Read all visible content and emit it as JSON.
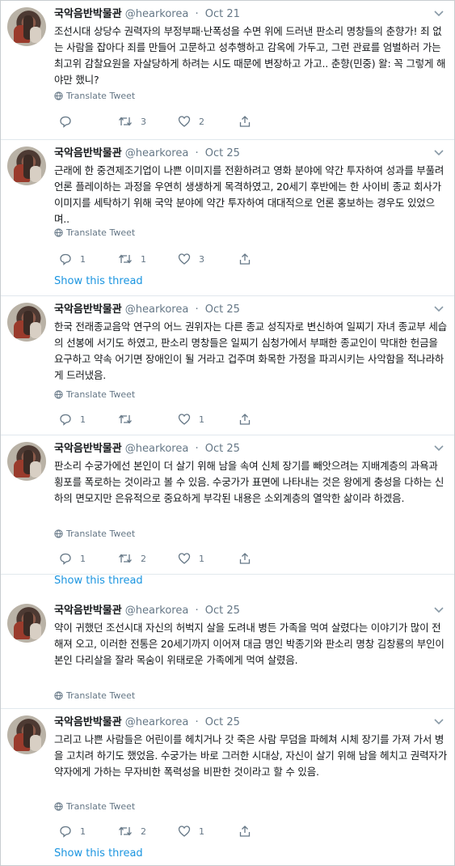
{
  "labels": {
    "translate": "Translate Tweet",
    "show_thread": "Show this thread"
  },
  "colors": {
    "link": "#1b95e0",
    "muted": "#657786",
    "text": "#14171a"
  },
  "tweets": [
    {
      "name": "국악음반박물관",
      "handle": "@hearkorea",
      "date": "Oct 21",
      "text": "조선시대 상당수 권력자의 부정부패·난폭성을 수면 위에 드러낸 판소리 명창들의 춘향가! 죄 없는 사람을 잡아다 죄를 만들어 고문하고 성추행하고 감옥에 가두고, 그런 관료를 엄벌하러 가는 최고위 감찰요원을 자살당하게 하려는 시도 때문에 변장하고 가고.. 춘향(민중) 왈: 꼭 그렇게 해야만 했니?",
      "replies": "",
      "retweets": "3",
      "likes": "2",
      "show_thread": false
    },
    {
      "name": "국악음반박물관",
      "handle": "@hearkorea",
      "date": "Oct 25",
      "text": "근래에 한 중견제조기업이 나쁜 이미지를 전환하려고 영화 분야에 약간 투자하여 성과를 부풀려 언론 플레이하는 과정을 우연히 생생하게 목격하였고, 20세기 후반에는 한 사이비 종교 회사가 이미지를 세탁하기 위해 국악 분야에 약간 투자하여 대대적으로 언론 홍보하는 경우도 있었으며..",
      "replies": "1",
      "retweets": "1",
      "likes": "3",
      "show_thread": true
    },
    {
      "name": "국악음반박물관",
      "handle": "@hearkorea",
      "date": "Oct 25",
      "text": "한국 전래종교음악 연구의 어느 권위자는 다른 종교 성직자로 변신하여 일찌기 자녀 종교부 세습의 선봉에 서기도 하였고, 판소리 명창들은 일찌기 심청가에서 부패한 종교인이 막대한 헌금을 요구하고 약속 어기면 장애인이 될 거라고 겁주며 화목한 가정을 파괴시키는 사악함을 적나라하게 드러냈음.",
      "replies": "1",
      "retweets": "",
      "likes": "1",
      "show_thread": false
    },
    {
      "name": "국악음반박물관",
      "handle": "@hearkorea",
      "date": "Oct 25",
      "text": "판소리 수궁가에선 본인이 더 살기 위해 남을 속여 신체 장기를 빼앗으려는 지배계층의 과욕과 횡포를 폭로하는 것이라고 볼 수 있음. 수궁가가 표면에 나타내는 것은 왕에게 충성을 다하는 신하의 면모지만 은유적으로 중요하게 부각된 내용은 소외계층의 열악한 삶이라 하겠음.",
      "replies": "1",
      "retweets": "2",
      "likes": "1",
      "show_thread": true
    },
    {
      "name": "국악음반박물관",
      "handle": "@hearkorea",
      "date": "Oct 25",
      "text": "약이 귀했던 조선시대 자신의 허벅지 살을 도려내 병든 가족을 먹여 살렸다는 이야기가 많이 전해져 오고, 이러한 전통은 20세기까지 이어져 대금 명인 박종기와 판소리 명창 김창룡의 부인이 본인 다리살을 잘라 목숨이 위태로운 가족에게 먹여 살렸음.",
      "replies": "",
      "retweets": "",
      "likes": "",
      "show_thread": false
    },
    {
      "name": "국악음반박물관",
      "handle": "@hearkorea",
      "date": "Oct 25",
      "text": "그리고 나쁜 사람들은 어린이를 헤치거나 갓 죽은 사람 무덤을 파헤쳐 시체 장기를 가져 가서 병을 고치려 하기도 했었음. 수궁가는 바로 그러한 시대상, 자신이 살기 위해 남을 헤치고 권력자가 약자에게 가하는 무자비한 폭력성을 비판한 것이라고 할 수 있음.",
      "replies": "1",
      "retweets": "2",
      "likes": "1",
      "show_thread": true
    }
  ]
}
